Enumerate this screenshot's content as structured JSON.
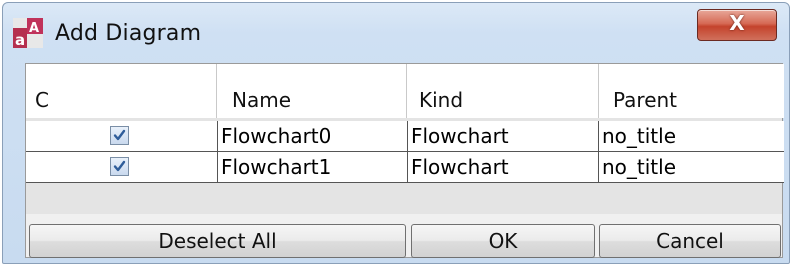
{
  "window": {
    "title": "Add Diagram",
    "icon": "astah-app-icon",
    "close_glyph": "X"
  },
  "table": {
    "columns": [
      "C",
      "Name",
      "Kind",
      "Parent"
    ],
    "rows": [
      {
        "checked": true,
        "name": "Flowchart0",
        "kind": "Flowchart",
        "parent": "no_title"
      },
      {
        "checked": true,
        "name": "Flowchart1",
        "kind": "Flowchart",
        "parent": "no_title"
      }
    ]
  },
  "buttons": {
    "deselect_all": "Deselect All",
    "ok": "OK",
    "cancel": "Cancel"
  },
  "colors": {
    "title_bar": "#cfe0f3",
    "close_button": "#c4432c",
    "checkbox_check": "#2f5d9a"
  }
}
